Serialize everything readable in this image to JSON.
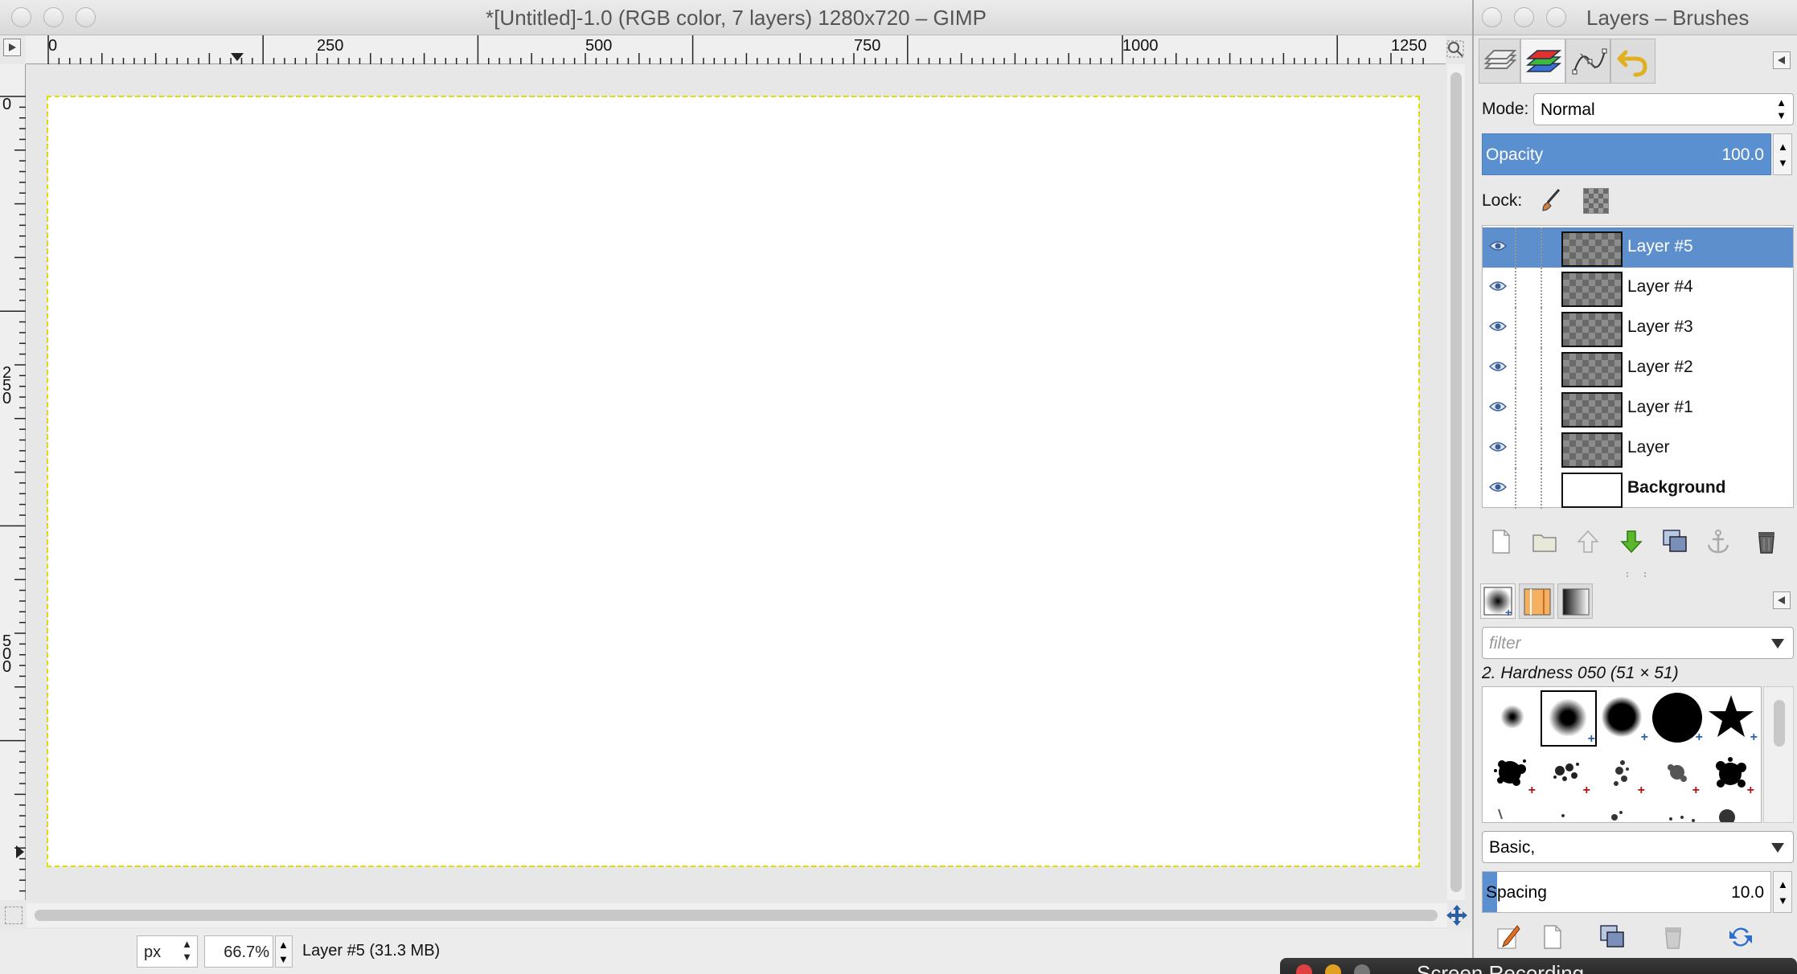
{
  "image_window": {
    "title": "*[Untitled]-1.0 (RGB color, 7 layers) 1280x720 – GIMP",
    "ruler_h_labels": [
      "0",
      "250",
      "500",
      "750",
      "1000",
      "1250"
    ],
    "ruler_v_labels": [
      "0",
      "2\n5\n0",
      "5\n0\n0"
    ],
    "status": {
      "unit": "px",
      "zoom": "66.7%",
      "message": "Layer #5 (31.3 MB)"
    }
  },
  "dock": {
    "title": "Layers – Brushes",
    "mode_label": "Mode:",
    "mode_value": "Normal",
    "opacity_label": "Opacity",
    "opacity_value": "100.0",
    "lock_label": "Lock:",
    "layers": [
      {
        "name": "Layer #5",
        "selected": true
      },
      {
        "name": "Layer #4",
        "selected": false
      },
      {
        "name": "Layer #3",
        "selected": false
      },
      {
        "name": "Layer #2",
        "selected": false
      },
      {
        "name": "Layer #1",
        "selected": false
      },
      {
        "name": "Layer",
        "selected": false
      },
      {
        "name": "Background",
        "selected": false
      }
    ],
    "brushes": {
      "filter_placeholder": "filter",
      "selected_brush": "2. Hardness 050 (51 × 51)",
      "preset": "Basic,",
      "spacing_label": "Spacing",
      "spacing_value": "10.0"
    }
  },
  "screen_recording_label": "Screen Recording",
  "colors": {
    "selection": "#5d8fcc",
    "accent_green": "#5bb82e",
    "dash_yellow": "#e0e000"
  }
}
